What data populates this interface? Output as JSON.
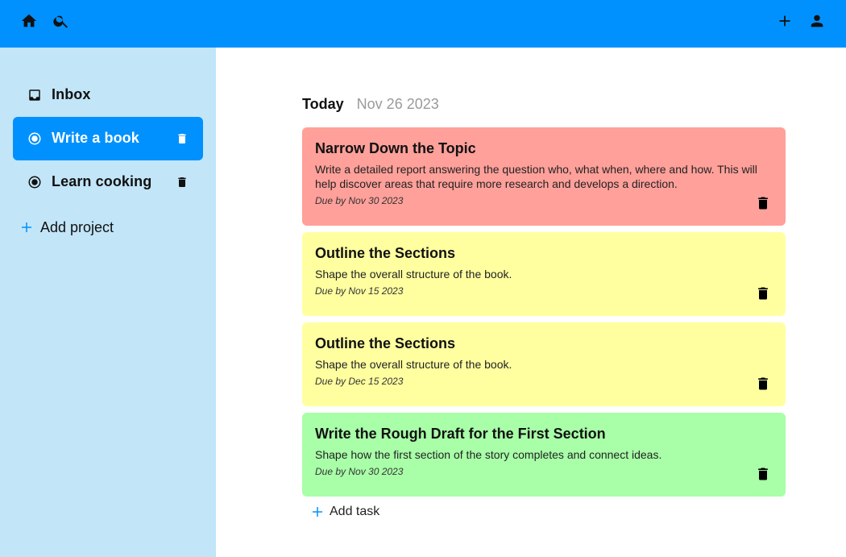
{
  "topbar": {
    "left_icons": [
      "home-icon",
      "search-icon"
    ],
    "right_icons": [
      "plus-icon",
      "account-icon"
    ],
    "color": "#0091ff"
  },
  "sidebar": {
    "items": [
      {
        "label": "Inbox",
        "icon": "inbox-icon",
        "deletable": false,
        "active": false
      },
      {
        "label": "Write a book",
        "icon": "radio-icon",
        "deletable": true,
        "active": true
      },
      {
        "label": "Learn cooking",
        "icon": "radio-icon",
        "deletable": true,
        "active": false
      }
    ],
    "add_project_label": "Add project",
    "background": "#c2e5f8",
    "active_color": "#0091ff"
  },
  "main": {
    "heading": {
      "day": "Today",
      "date": "Nov 26 2023"
    },
    "tasks": [
      {
        "title": "Narrow Down the Topic",
        "description": "Write a detailed report answering the question who, what when, where and how. This will help discover areas that require more research and develops a direction.",
        "due": "Due by Nov 30 2023",
        "color": "#ffa09a"
      },
      {
        "title": "Outline the Sections",
        "description": "Shape the overall structure of the book.",
        "due": "Due by Nov 15 2023",
        "color": "#ffffa0"
      },
      {
        "title": "Outline the Sections",
        "description": "Shape the overall structure of the book.",
        "due": "Due by Dec 15 2023",
        "color": "#ffffa0"
      },
      {
        "title": "Write the Rough Draft for the First Section",
        "description": "Shape how the first section of the story completes and connect ideas.",
        "due": "Due by Nov 30 2023",
        "color": "#a8ffa8"
      }
    ],
    "add_task_label": "Add task"
  }
}
